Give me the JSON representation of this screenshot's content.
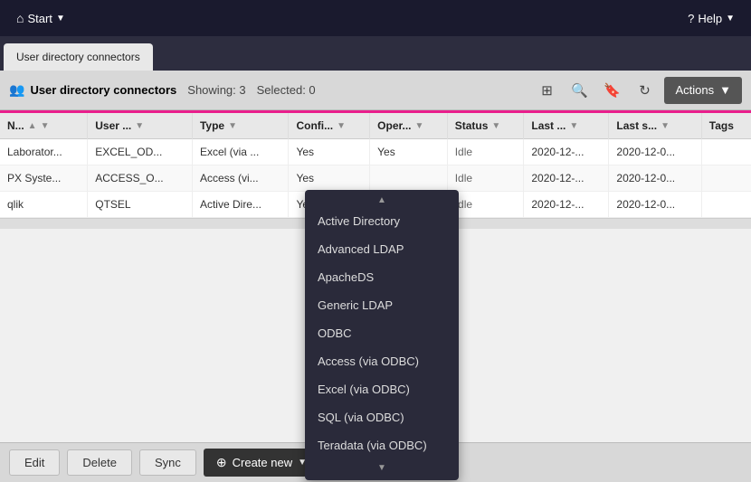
{
  "topNav": {
    "startLabel": "Start",
    "helpLabel": "Help",
    "startIcon": "🏠"
  },
  "tabBar": {
    "activeTab": "User directory connectors"
  },
  "toolbar": {
    "title": "User directory connectors",
    "showing": "Showing: 3",
    "selected": "Selected: 0",
    "actionsLabel": "Actions"
  },
  "table": {
    "columns": [
      {
        "label": "N...",
        "sortable": true,
        "filterable": true
      },
      {
        "label": "User ...",
        "sortable": false,
        "filterable": true
      },
      {
        "label": "Type",
        "sortable": false,
        "filterable": true
      },
      {
        "label": "Confi...",
        "sortable": false,
        "filterable": true
      },
      {
        "label": "Oper...",
        "sortable": false,
        "filterable": true
      },
      {
        "label": "Status",
        "sortable": false,
        "filterable": true
      },
      {
        "label": "Last ...",
        "sortable": false,
        "filterable": true
      },
      {
        "label": "Last s...",
        "sortable": false,
        "filterable": true
      },
      {
        "label": "Tags",
        "sortable": false,
        "filterable": false
      }
    ],
    "rows": [
      {
        "name": "Laborator...",
        "user": "EXCEL_OD...",
        "type": "Excel (via ...",
        "config": "Yes",
        "oper": "Yes",
        "status": "Idle",
        "last": "2020-12-...",
        "lasts": "2020-12-0...",
        "tags": ""
      },
      {
        "name": "PX Syste...",
        "user": "ACCESS_O...",
        "type": "Access (vi...",
        "config": "Yes",
        "oper": "",
        "status": "Idle",
        "last": "2020-12-...",
        "lasts": "2020-12-0...",
        "tags": ""
      },
      {
        "name": "qlik",
        "user": "QTSEL",
        "type": "Active Dire...",
        "config": "Yes",
        "oper": "",
        "status": "Idle",
        "last": "2020-12-...",
        "lasts": "2020-12-0...",
        "tags": ""
      }
    ]
  },
  "dropdown": {
    "items": [
      "Active Directory",
      "Advanced LDAP",
      "ApacheDS",
      "Generic LDAP",
      "ODBC",
      "Access (via ODBC)",
      "Excel (via ODBC)",
      "SQL (via ODBC)",
      "Teradata (via ODBC)"
    ]
  },
  "bottomBar": {
    "editLabel": "Edit",
    "deleteLabel": "Delete",
    "syncLabel": "Sync",
    "createNewLabel": "Create new"
  }
}
